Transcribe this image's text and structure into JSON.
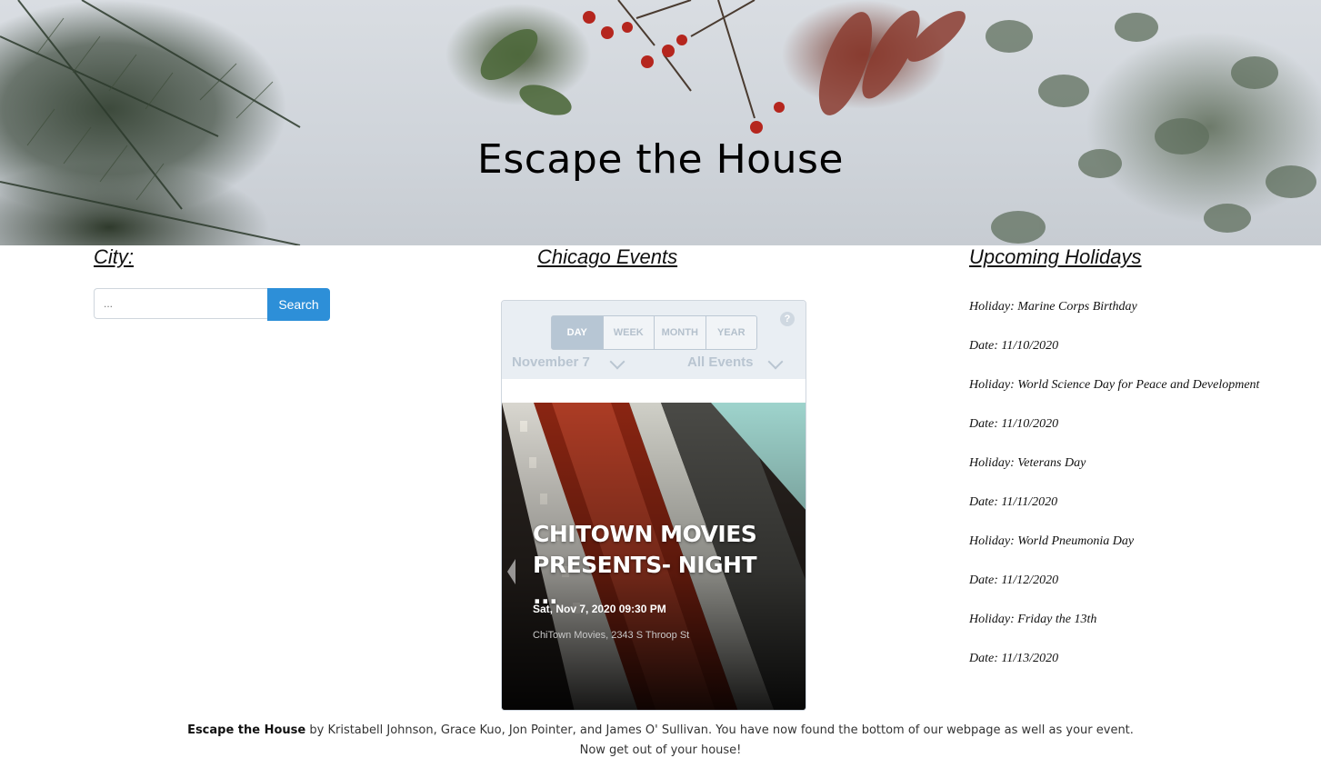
{
  "hero": {
    "title": "Escape the House"
  },
  "city": {
    "heading": "City:",
    "placeholder": "...",
    "search_label": "Search"
  },
  "events": {
    "heading": "Chicago Events",
    "tabs": [
      "DAY",
      "WEEK",
      "MONTH",
      "YEAR"
    ],
    "active_tab": "DAY",
    "help_glyph": "?",
    "date": "November 7",
    "filter": "All Events",
    "event": {
      "title": "CHITOWN MOVIES PRESENTS- NIGHT ...",
      "datetime": "Sat, Nov 7, 2020 09:30 PM",
      "venue": "ChiTown Movies, 2343 S Throop St"
    }
  },
  "holidays": {
    "heading": "Upcoming Holidays",
    "items": [
      {
        "holiday": "Holiday: Marine Corps Birthday",
        "date": "Date: 11/10/2020"
      },
      {
        "holiday": "Holiday: World Science Day for Peace and Development",
        "date": "Date: 11/10/2020"
      },
      {
        "holiday": "Holiday: Veterans Day",
        "date": "Date: 11/11/2020"
      },
      {
        "holiday": "Holiday: World Pneumonia Day",
        "date": "Date: 11/12/2020"
      },
      {
        "holiday": "Holiday: Friday the 13th",
        "date": "Date: 11/13/2020"
      }
    ]
  },
  "footer": {
    "brand": "Escape the House",
    "line1": " by Kristabell Johnson, Grace Kuo, Jon Pointer, and James O' Sullivan. You have now found the bottom of our webpage as well as your event.",
    "line2": "Now get out of your house!"
  },
  "colors": {
    "accent": "#2d8fd8",
    "widget_muted": "#b9c5d1"
  }
}
